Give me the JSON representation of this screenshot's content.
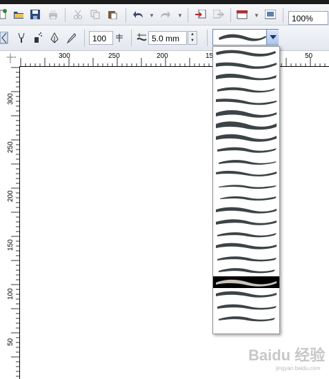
{
  "toolbar": {
    "zoom_value": "100%"
  },
  "property_bar": {
    "width_value": "100",
    "size_value": "5.0 mm"
  },
  "rulers": {
    "horizontal_labels": [
      "300",
      "250",
      "200",
      "15",
      "50"
    ],
    "vertical_labels": [
      "300",
      "250",
      "200",
      "150",
      "100",
      "50"
    ]
  },
  "stroke_dropdown": {
    "item_count": 23,
    "selected_index": 19
  },
  "watermark": {
    "text": "Baidu 经验",
    "sub": "jingyan.baidu.com"
  },
  "colors": {
    "stroke": "#3c4446",
    "selected_bg": "#000000",
    "selected_stroke": "#c8c4bc"
  }
}
